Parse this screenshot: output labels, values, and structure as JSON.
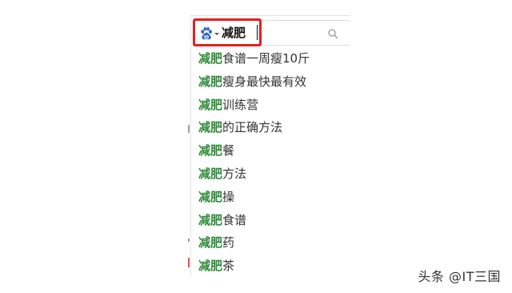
{
  "search": {
    "engine_icon": "baidu-paw-icon",
    "query": "减肥",
    "button_icon": "search-icon",
    "highlight_color": "#e02020"
  },
  "suggestions": {
    "keyword_color": "#2e8b3a",
    "items": [
      {
        "keyword": "减肥",
        "rest": "食谱一周瘦10斤"
      },
      {
        "keyword": "减肥",
        "rest": "瘦身最快最有效"
      },
      {
        "keyword": "减肥",
        "rest": "训练营"
      },
      {
        "keyword": "减肥",
        "rest": "的正确方法"
      },
      {
        "keyword": "减肥",
        "rest": "餐"
      },
      {
        "keyword": "减肥",
        "rest": "方法"
      },
      {
        "keyword": "减肥",
        "rest": "操"
      },
      {
        "keyword": "减肥",
        "rest": "食谱"
      },
      {
        "keyword": "减肥",
        "rest": "药"
      },
      {
        "keyword": "减肥",
        "rest": "茶"
      }
    ]
  },
  "watermark": {
    "text": "头条 @IT三国"
  }
}
